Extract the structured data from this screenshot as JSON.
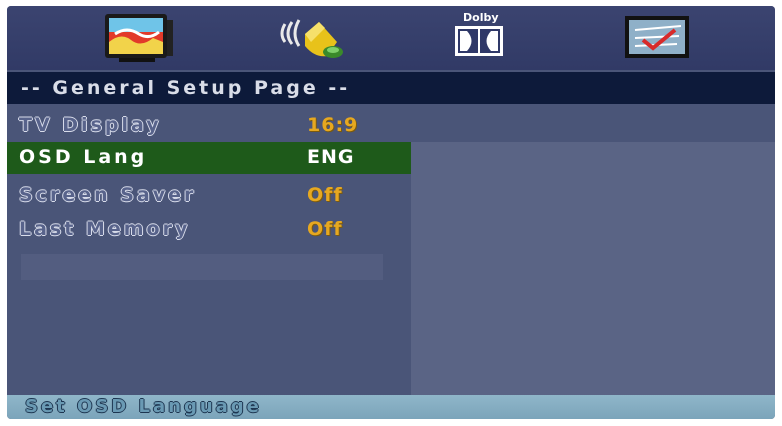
{
  "tabs": [
    {
      "icon": "general-setup-icon"
    },
    {
      "icon": "audio-setup-icon"
    },
    {
      "icon": "dolby-setup-icon",
      "text": "Dolby"
    },
    {
      "icon": "preference-setup-icon"
    }
  ],
  "title": "-- General Setup Page --",
  "menu": [
    {
      "label": "TV Display",
      "value": "16:9",
      "selected": false
    },
    {
      "label": "OSD Lang",
      "value": "ENG",
      "selected": true
    },
    {
      "label": "Screen Saver",
      "value": "Off",
      "selected": false
    },
    {
      "label": "Last Memory",
      "value": "Off",
      "selected": false
    }
  ],
  "help": "Set OSD Language",
  "colors": {
    "panel": "#4a5578",
    "title_bar": "#0d1a3a",
    "selected_row": "#1e5a1a",
    "value_text": "#e6a820",
    "help_bar": "#8fb6c9"
  }
}
